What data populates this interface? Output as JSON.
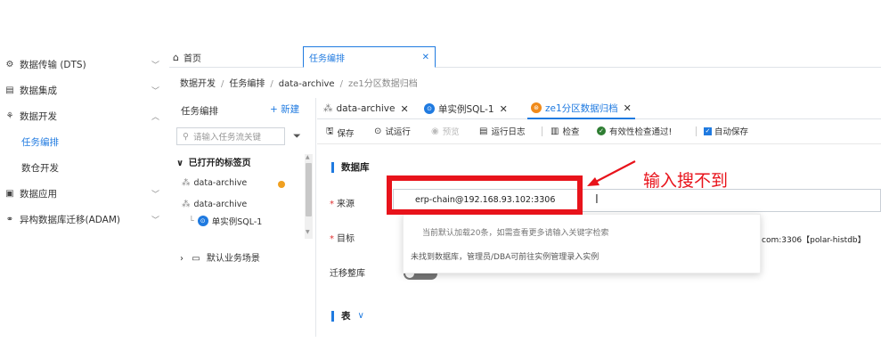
{
  "sidebar": {
    "items": [
      {
        "label": "数据传输 (DTS)",
        "icon": "dts-icon"
      },
      {
        "label": "数据集成",
        "icon": "integration-icon"
      },
      {
        "label": "数据开发",
        "icon": "dev-icon",
        "children": [
          {
            "label": "任务编排"
          },
          {
            "label": "数仓开发"
          }
        ]
      },
      {
        "label": "数据应用",
        "icon": "app-icon"
      },
      {
        "label": "异构数据库迁移(ADAM)",
        "icon": "migration-icon"
      }
    ]
  },
  "top_tabs": {
    "home": "首页",
    "active": "任务编排"
  },
  "breadcrumb": {
    "items": [
      "数据开发",
      "任务编排",
      "data-archive",
      "ze1分区数据归档"
    ],
    "separator": "/"
  },
  "tree": {
    "title": "任务编排",
    "new_label": "+ 新建",
    "search_placeholder": "请输入任务流关键",
    "section": "已打开的标签页",
    "nodes": [
      "data-archive",
      "data-archive",
      "单实例SQL-1"
    ],
    "business": "默认业务场景"
  },
  "editor_tabs": [
    {
      "label": "data-archive"
    },
    {
      "label": "单实例SQL-1"
    },
    {
      "label": "ze1分区数据归档"
    }
  ],
  "toolbar": {
    "save": "保存",
    "trial_run": "试运行",
    "preview": "预览",
    "run_log": "运行日志",
    "check": "检查",
    "validity": "有效性检查通过!",
    "autosave": "自动保存"
  },
  "form": {
    "section_db": "数据库",
    "source_label": "来源",
    "source_value": "erp-chain@192.168.93.102:3306",
    "target_label": "目标",
    "target_value": "com:3306【polar-histdb】",
    "migrate_label": "迁移整库",
    "dropdown_tip": "当前默认加载20条，如需查看更多请输入关键字检索",
    "dropdown_empty": "未找到数据库，管理员/DBA可前往实例管理录入实例",
    "section_table": "表"
  },
  "annotation": {
    "text": "输入搜不到",
    "color": "#e8131b"
  },
  "colors": {
    "accent": "#1f7ae0",
    "annotation": "#e8131b"
  }
}
